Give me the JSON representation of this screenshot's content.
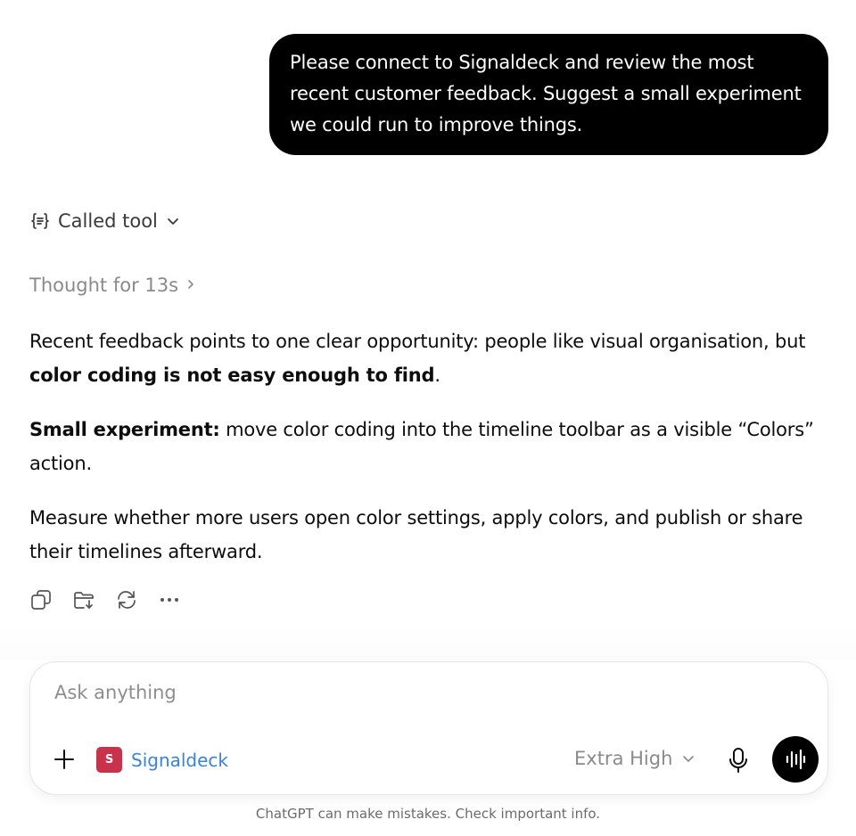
{
  "user_message": {
    "text": "Please connect to Signaldeck and review the most recent customer feedback. Suggest a small experiment we could run to improve things."
  },
  "tool_call": {
    "label": "Called tool",
    "icon": "tool-braces-icon"
  },
  "thought": {
    "label": "Thought for 13s",
    "icon": "chevron-right-icon"
  },
  "answer": {
    "p1_text": "Recent feedback points to one clear opportunity: people like visual organisation, but ",
    "p1_bold": "color coding is not easy enough to find",
    "p1_end": ".",
    "p2_bold": "Small experiment:",
    "p2_text": " move color coding into the timeline toolbar as a visible “Colors” action.",
    "p3_text": "Measure whether more users open color settings, apply colors, and publish or share their timelines afterward."
  },
  "actions": {
    "icons": [
      "copy-icon",
      "save-to-folder-icon",
      "regenerate-icon",
      "more-icon"
    ]
  },
  "composer": {
    "placeholder": "Ask anything",
    "value": "",
    "connector": {
      "badge": "S",
      "name": "Signaldeck",
      "color": "#c8324b",
      "name_color": "#3a83d8"
    },
    "model": "Extra High"
  },
  "disclaimer": "ChatGPT can make mistakes. Check important info."
}
